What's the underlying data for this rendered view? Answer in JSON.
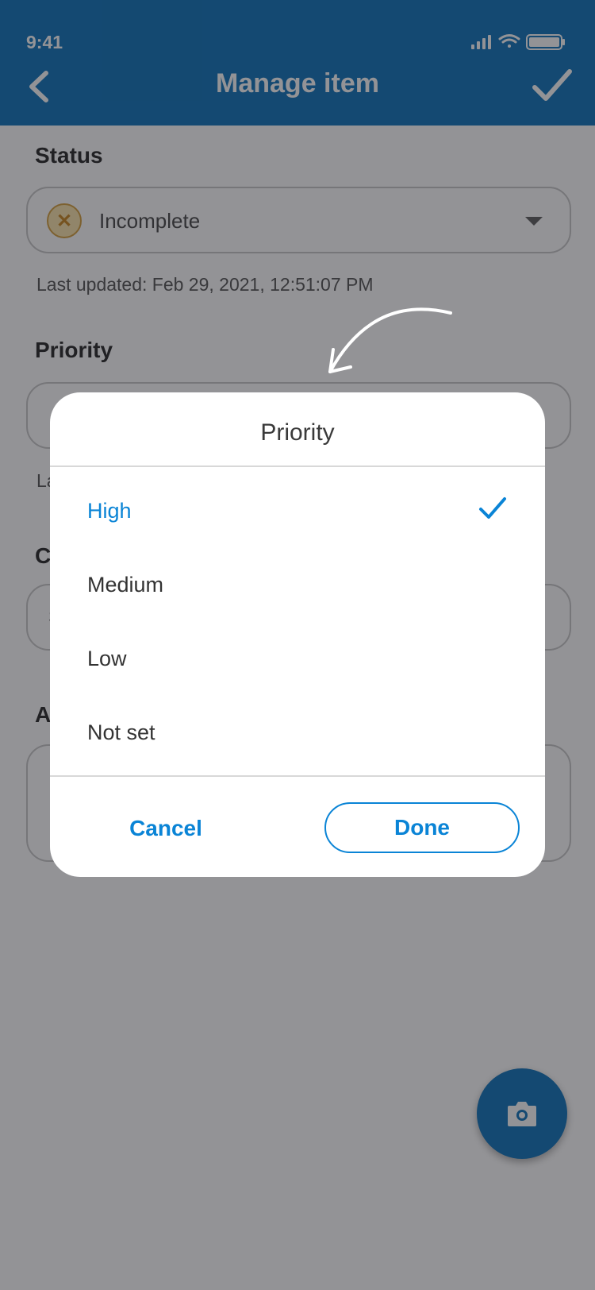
{
  "status_bar": {
    "time": "9:41"
  },
  "header": {
    "title": "Manage item"
  },
  "status_section": {
    "label": "Status",
    "value": "Incomplete",
    "last_updated": "Last updated: Feb 29, 2021, 12:51:07 PM"
  },
  "priority_section": {
    "label": "Priority",
    "last_updated_peek": "La"
  },
  "peeks": {
    "section3_letter": "C",
    "section3_field_letter": "S",
    "section4_letter": "A"
  },
  "modal": {
    "title": "Priority",
    "options": [
      {
        "label": "High",
        "selected": true
      },
      {
        "label": "Medium",
        "selected": false
      },
      {
        "label": "Low",
        "selected": false
      },
      {
        "label": "Not set",
        "selected": false
      }
    ],
    "cancel_label": "Cancel",
    "done_label": "Done"
  },
  "colors": {
    "primary": "#006bb6",
    "accent": "#0a84d6",
    "incomplete_icon": "#d39b33"
  },
  "icons": [
    "back-icon",
    "checkmark-icon",
    "camera-icon",
    "close-icon",
    "caret-down-icon",
    "signal-icon",
    "wifi-icon",
    "battery-icon"
  ]
}
